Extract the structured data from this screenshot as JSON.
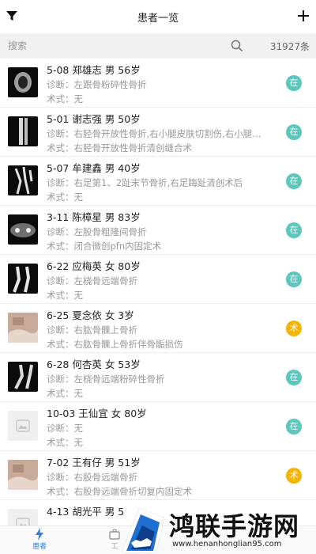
{
  "header": {
    "title": "患者一览"
  },
  "search": {
    "placeholder": "搜索",
    "count": "31927条"
  },
  "colors": {
    "badge_in": "#5bc8be",
    "badge_surgery": "#f5b400"
  },
  "patients": [
    {
      "name_line": "5-08 郑雄志  男  56岁",
      "diagnosis": "诊断：左跟骨粉碎性骨折",
      "surgery": "术式：无",
      "status": "在",
      "status_kind": "in",
      "thumb": "xray"
    },
    {
      "name_line": "5-01 谢志强  男  50岁",
      "diagnosis": "诊断：右胫骨开放性骨折,右小腿皮肤切割伤,右小腿…",
      "surgery": "术式：右胫骨开放性骨折清创缝合术",
      "status": "在",
      "status_kind": "in",
      "thumb": "xray"
    },
    {
      "name_line": "5-07 牟建鑫  男  40岁",
      "diagnosis": "诊断：右足第1、2趾末节骨折,右足踇趾清创术后",
      "surgery": "术式：无",
      "status": "在",
      "status_kind": "in",
      "thumb": "xray"
    },
    {
      "name_line": "3-11 陈樟星  男  83岁",
      "diagnosis": "诊断：左股骨粗隆间骨折",
      "surgery": "术式：闭合微创pfn内固定术",
      "status": "在",
      "status_kind": "in",
      "thumb": "xray"
    },
    {
      "name_line": "6-22 应梅英  女  80岁",
      "diagnosis": "诊断：左桡骨远端骨折",
      "surgery": "术式：无",
      "status": "在",
      "status_kind": "in",
      "thumb": "xray"
    },
    {
      "name_line": "6-25 夏念依  女  3岁",
      "diagnosis": "诊断：右肱骨髁上骨折",
      "surgery": "术式：右肱骨髁上骨折伴骨骺损伤",
      "status": "术",
      "status_kind": "surgery",
      "thumb": "photo"
    },
    {
      "name_line": "6-28 何杏英  女  53岁",
      "diagnosis": "诊断：左桡骨远端粉碎性骨折",
      "surgery": "术式：无",
      "status": "在",
      "status_kind": "in",
      "thumb": "xray"
    },
    {
      "name_line": "10-03 王仙宜  女  80岁",
      "diagnosis": "诊断：无",
      "surgery": "术式：无",
      "status": "在",
      "status_kind": "in",
      "thumb": "placeholder"
    },
    {
      "name_line": "7-02 王有仔  男  51岁",
      "diagnosis": "诊断：右股骨远端骨折",
      "surgery": "术式：右股骨远端骨折切复内固定术",
      "status": "术",
      "status_kind": "surgery",
      "thumb": "photo"
    },
    {
      "name_line": "4-13 胡光平  男  5",
      "diagnosis": "",
      "surgery": "",
      "status": "",
      "status_kind": "none",
      "thumb": "placeholder"
    }
  ],
  "tabbar": {
    "tab_patients": "患者",
    "tab_work": "工"
  },
  "watermark": {
    "title": "鸿联手游网",
    "url": "www.henanhonglian95.com"
  }
}
